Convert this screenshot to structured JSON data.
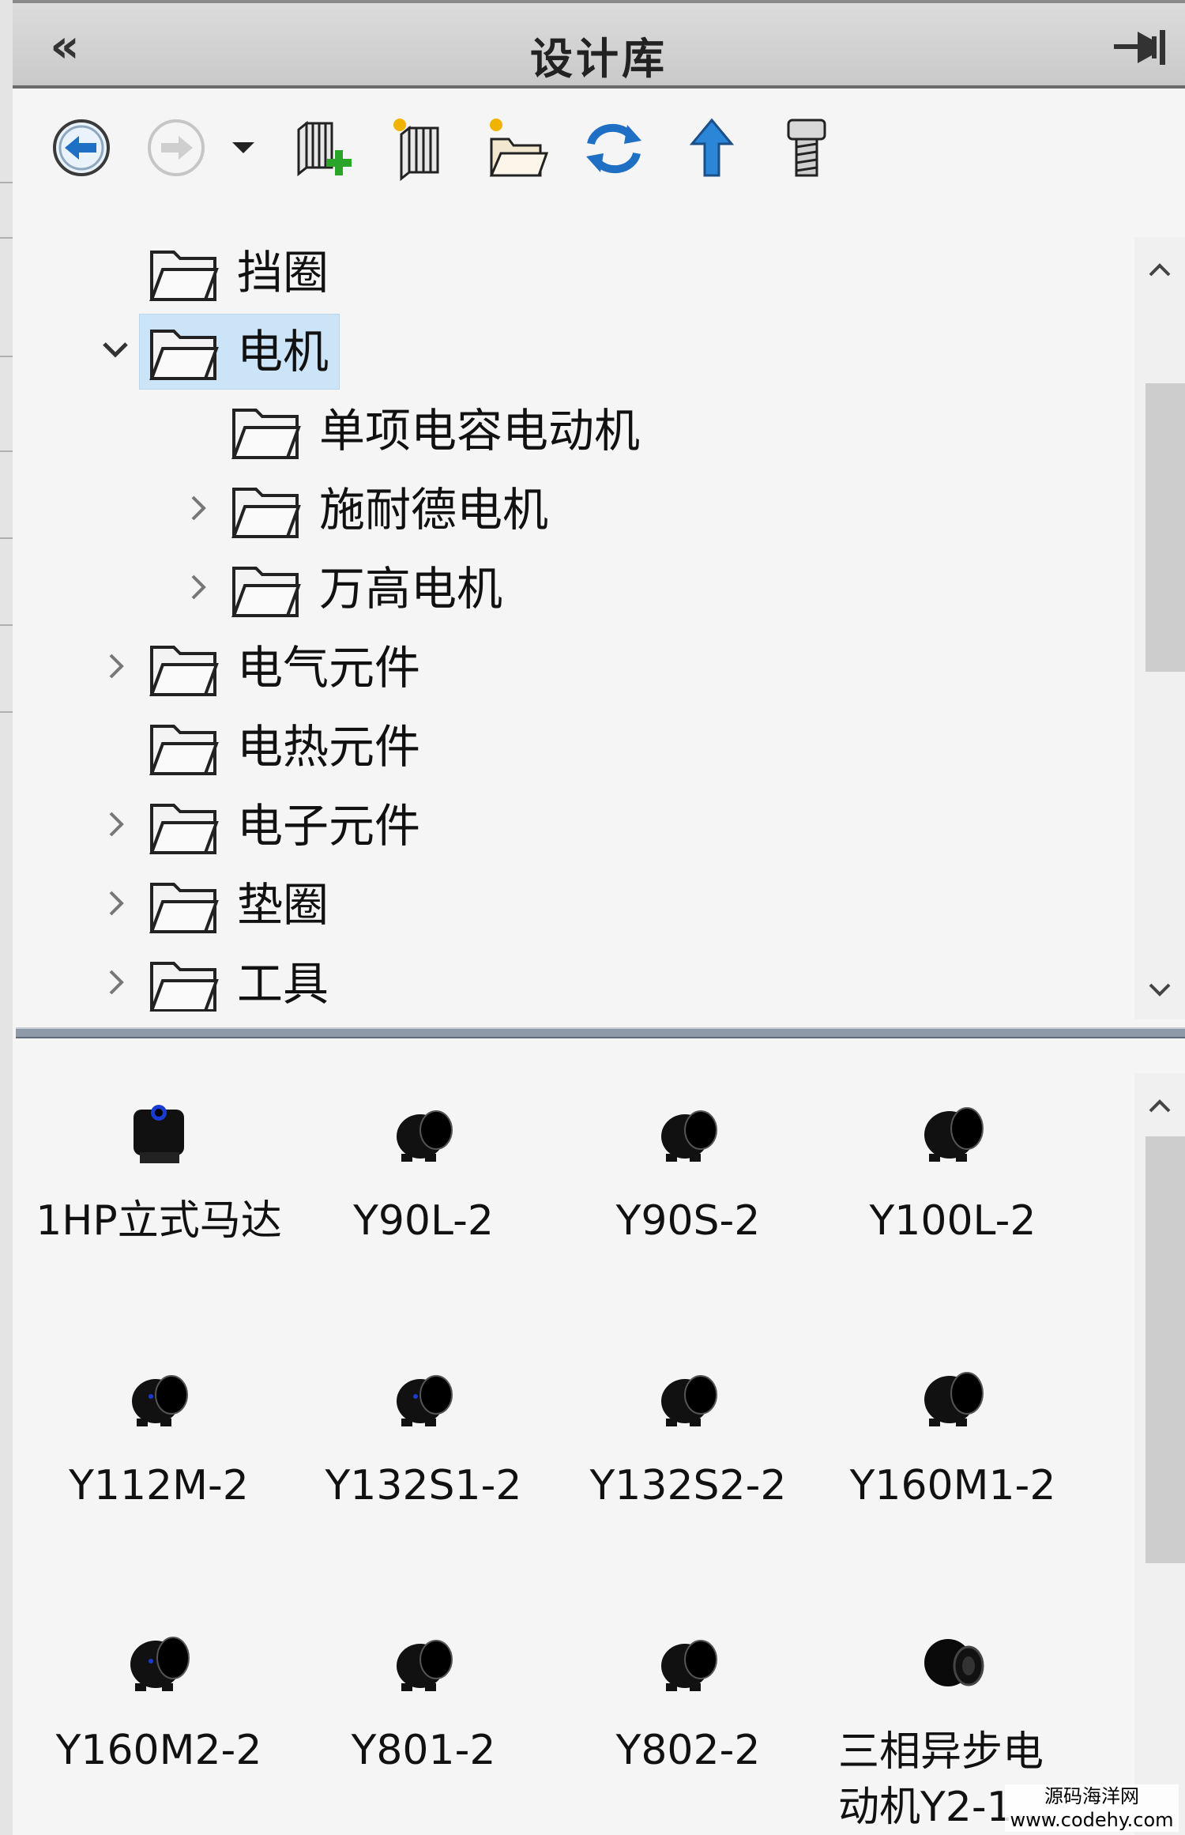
{
  "panel": {
    "title": "设计库",
    "collapse_glyph": "«",
    "pin_icon": "pin-icon"
  },
  "toolbar": {
    "buttons": [
      {
        "name": "back-button",
        "icon": "back-arrow-icon"
      },
      {
        "name": "forward-button",
        "icon": "forward-arrow-icon",
        "disabled": true
      },
      {
        "name": "history-dropdown",
        "icon": "dropdown-icon"
      },
      {
        "name": "add-file-location-button",
        "icon": "add-library-icon"
      },
      {
        "name": "create-new-library-button",
        "icon": "new-library-icon"
      },
      {
        "name": "create-new-folder-button",
        "icon": "new-folder-icon"
      },
      {
        "name": "refresh-button",
        "icon": "refresh-icon"
      },
      {
        "name": "up-one-level-button",
        "icon": "up-arrow-icon"
      },
      {
        "name": "toolbox-button",
        "icon": "bolt-icon"
      }
    ]
  },
  "tree": {
    "items": [
      {
        "label": "挡圈",
        "level": 1,
        "chevron": "none"
      },
      {
        "label": "电机",
        "level": 1,
        "chevron": "expanded",
        "selected": true
      },
      {
        "label": "单项电容电动机",
        "level": 2,
        "chevron": "none"
      },
      {
        "label": "施耐德电机",
        "level": 2,
        "chevron": "collapsed"
      },
      {
        "label": "万高电机",
        "level": 2,
        "chevron": "collapsed"
      },
      {
        "label": "电气元件",
        "level": 1,
        "chevron": "collapsed"
      },
      {
        "label": "电热元件",
        "level": 1,
        "chevron": "none"
      },
      {
        "label": "电子元件",
        "level": 1,
        "chevron": "collapsed"
      },
      {
        "label": "垫圈",
        "level": 1,
        "chevron": "collapsed"
      },
      {
        "label": "工具",
        "level": 1,
        "chevron": "collapsed"
      }
    ]
  },
  "items": [
    {
      "label": "1HP立式马达",
      "icon": "motor-thumbnail-icon"
    },
    {
      "label": "Y90L-2",
      "icon": "motor-thumbnail-icon"
    },
    {
      "label": "Y90S-2",
      "icon": "motor-thumbnail-icon"
    },
    {
      "label": "Y100L-2",
      "icon": "motor-thumbnail-icon"
    },
    {
      "label": "Y112M-2",
      "icon": "motor-thumbnail-icon"
    },
    {
      "label": "Y132S1-2",
      "icon": "motor-thumbnail-icon"
    },
    {
      "label": "Y132S2-2",
      "icon": "motor-thumbnail-icon"
    },
    {
      "label": "Y160M1-2",
      "icon": "motor-thumbnail-icon"
    },
    {
      "label": "Y160M2-2",
      "icon": "motor-thumbnail-icon"
    },
    {
      "label": "Y801-2",
      "icon": "motor-thumbnail-icon"
    },
    {
      "label": "Y802-2",
      "icon": "motor-thumbnail-icon"
    },
    {
      "label": "三相异步电动机Y2-1...",
      "icon": "motor-thumbnail-icon"
    }
  ],
  "watermark": {
    "line1": "源码海洋网",
    "line2": "www.codehy.com"
  },
  "colors": {
    "accent_blue": "#1f6fc5",
    "selection": "#cce4f7",
    "add_green": "#2aa52a"
  }
}
